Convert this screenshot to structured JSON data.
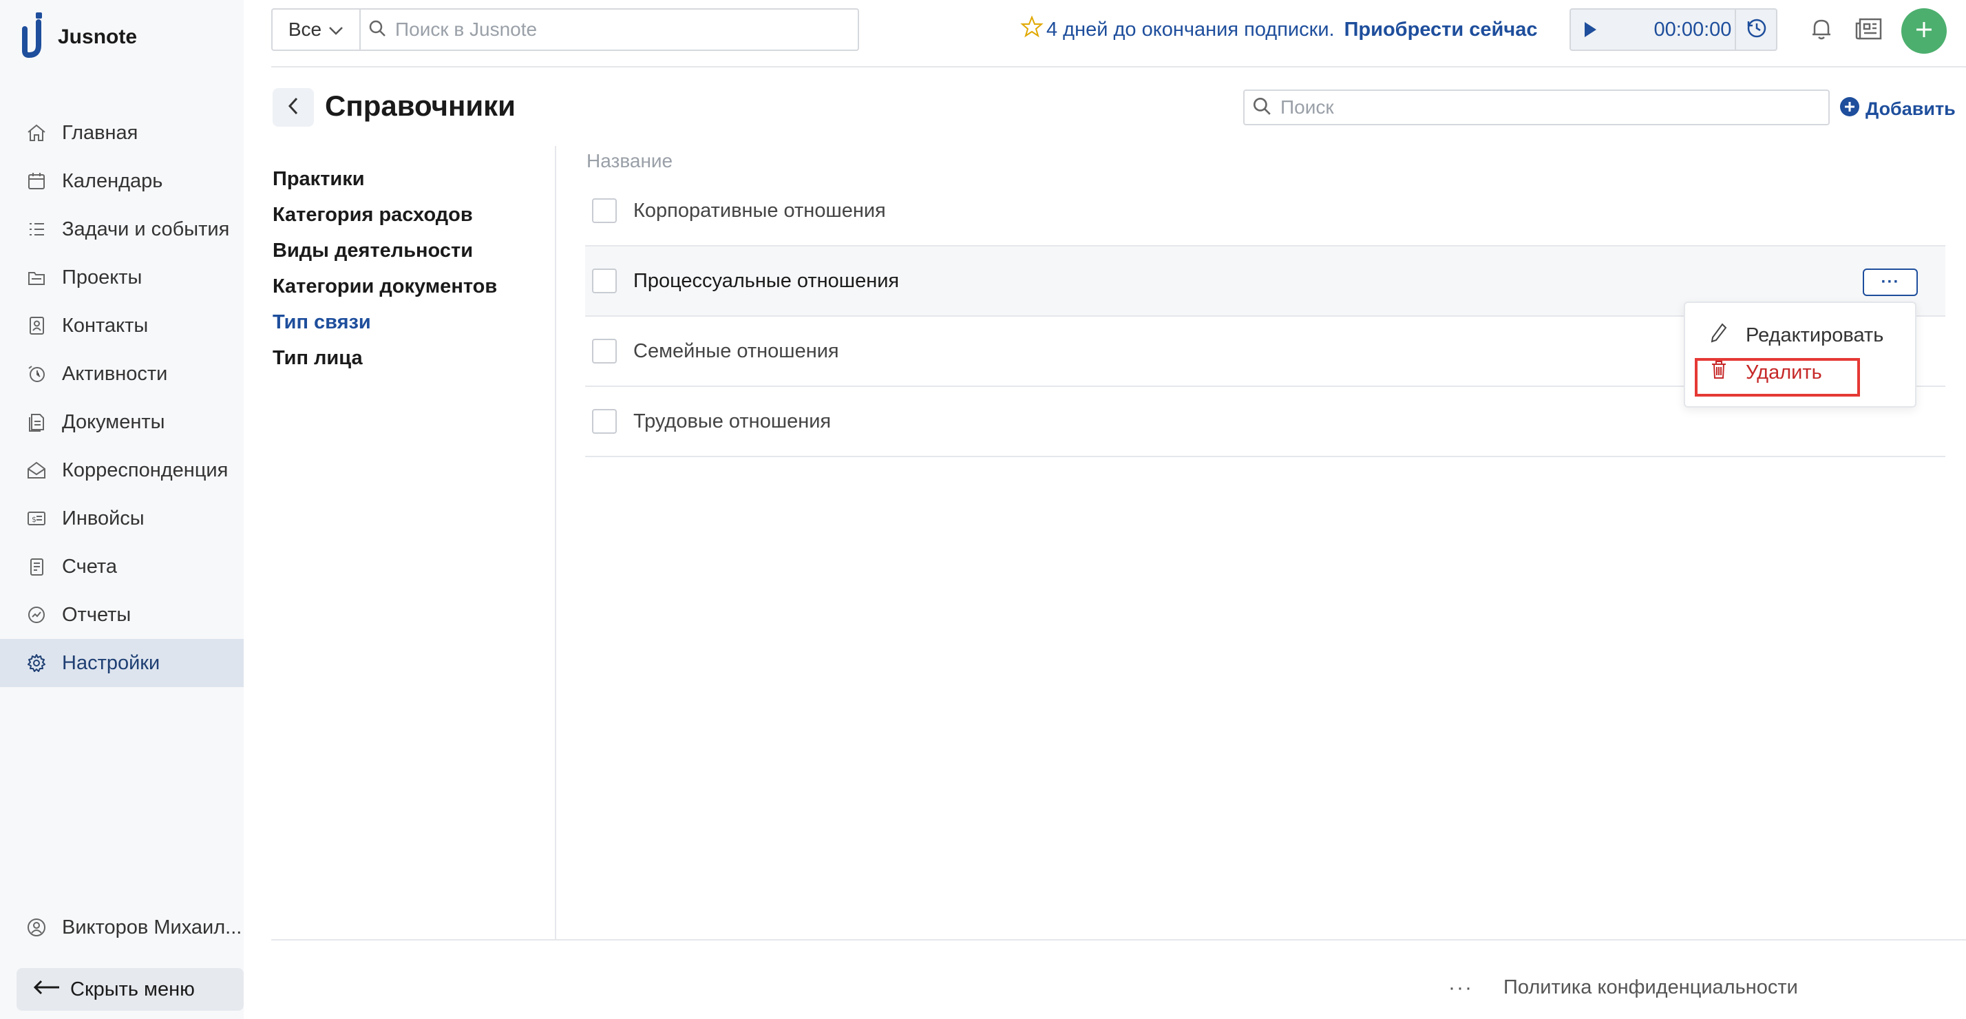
{
  "app": {
    "name": "Jusnote"
  },
  "sidebar": {
    "items": [
      {
        "label": "Главная",
        "icon": "home-icon"
      },
      {
        "label": "Календарь",
        "icon": "calendar-icon"
      },
      {
        "label": "Задачи и события",
        "icon": "tasks-icon"
      },
      {
        "label": "Проекты",
        "icon": "projects-icon"
      },
      {
        "label": "Контакты",
        "icon": "contacts-icon"
      },
      {
        "label": "Активности",
        "icon": "activity-icon"
      },
      {
        "label": "Документы",
        "icon": "documents-icon"
      },
      {
        "label": "Корреспонденция",
        "icon": "mail-icon"
      },
      {
        "label": "Инвойсы",
        "icon": "invoice-icon"
      },
      {
        "label": "Счета",
        "icon": "accounts-icon"
      },
      {
        "label": "Отчеты",
        "icon": "reports-icon"
      },
      {
        "label": "Настройки",
        "icon": "gear-icon",
        "active": true
      }
    ],
    "user": "Викторов Михаил...",
    "hide_menu": "Скрыть меню"
  },
  "topbar": {
    "scope": "Все",
    "search_placeholder": "Поиск в Jusnote",
    "subscription_text": "4 дней до окончания подписки.",
    "subscription_cta": "Приобрести сейчас",
    "timer": "00:00:00",
    "add_label": "+"
  },
  "page": {
    "title": "Справочники",
    "search_placeholder": "Поиск",
    "add_label": "Добавить"
  },
  "subnav": {
    "items": [
      {
        "label": "Практики"
      },
      {
        "label": "Категория расходов"
      },
      {
        "label": "Виды деятельности"
      },
      {
        "label": "Категории документов"
      },
      {
        "label": "Тип связи",
        "active": true
      },
      {
        "label": "Тип лица"
      }
    ]
  },
  "table": {
    "column": "Название",
    "rows": [
      {
        "label": "Корпоративные отношения"
      },
      {
        "label": "Процессуальные отношения",
        "hover": true
      },
      {
        "label": "Семейные отношения"
      },
      {
        "label": "Трудовые отношения"
      }
    ],
    "row_menu_label": "···"
  },
  "context_menu": {
    "edit": "Редактировать",
    "delete": "Удалить"
  },
  "footer": {
    "more": "···",
    "privacy": "Политика конфиденциальности"
  },
  "colors": {
    "accent": "#1e4e9c",
    "danger": "#c62828",
    "highlight": "#e53935",
    "add_button": "#4caf6e",
    "active_nav_bg": "#dde4ee"
  }
}
